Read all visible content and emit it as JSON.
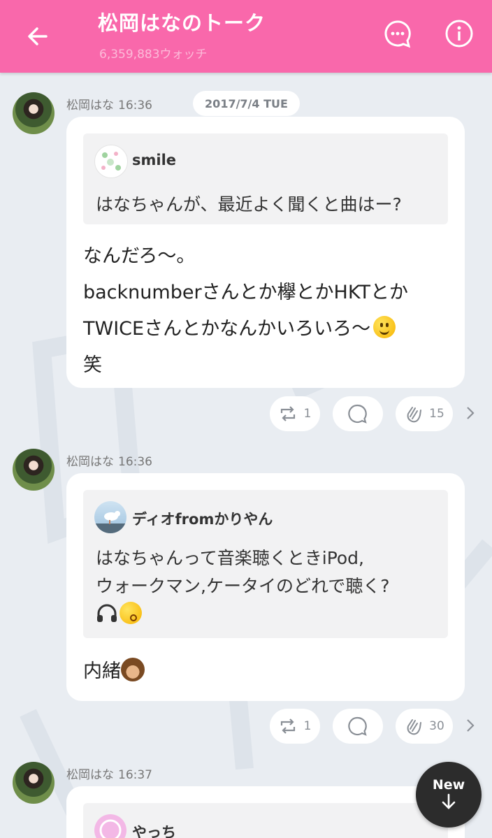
{
  "header": {
    "title": "松岡はなのトーク",
    "watch_count": "6,359,883ウォッチ",
    "colors": {
      "header_bg": "#f968ab",
      "page_bg": "#e9edf2"
    }
  },
  "date_divider": "2017/7/4 TUE",
  "posts": [
    {
      "author": "松岡はな",
      "time": "16:36",
      "quote": {
        "name": "smile",
        "text": "はなちゃんが、最近よく聞くと曲はー?"
      },
      "reply": "なんだろ〜。\nbacknumberさんとか欅とかHKTとか\nTWICEさんとかなんかいろいろ〜",
      "reply_tail": "笑",
      "retweets": "1",
      "claps": "15"
    },
    {
      "author": "松岡はな",
      "time": "16:36",
      "quote": {
        "name": "ディオfromかりやん",
        "text": "はなちゃんって音楽聴くときiPod,\nウォークマン,ケータイのどれで聴く?"
      },
      "reply": "内緒",
      "retweets": "1",
      "claps": "30"
    },
    {
      "author": "松岡はな",
      "time": "16:37",
      "quote": {
        "name": "やっち"
      }
    }
  ],
  "new_button": {
    "label": "New"
  },
  "icons": [
    "back-arrow-icon",
    "chat-bubble-icon",
    "info-icon",
    "retweet-icon",
    "comment-icon",
    "clap-icon",
    "chevron-right-icon",
    "arrow-down-icon"
  ]
}
